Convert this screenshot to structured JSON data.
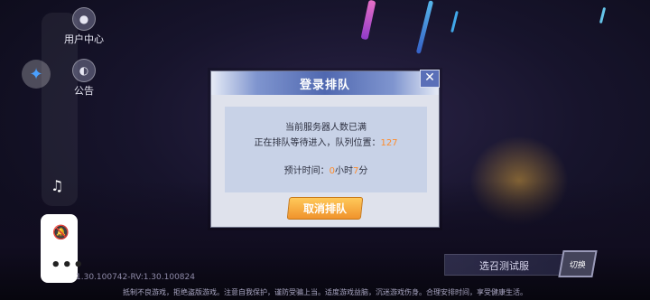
{
  "sidebar": {
    "user_center_label": "用户中心",
    "announcement_label": "公告"
  },
  "footer": {
    "version_text": "1.30.100742-RV:1.30.100824",
    "health_notice": "抵制不良游戏，拒绝盗版游戏。注意自我保护，谨防受骗上当。适度游戏益脑，沉迷游戏伤身。合理安排时间，享受健康生活。"
  },
  "server": {
    "select_label": "选召测试服",
    "switch_label": "切换"
  },
  "modal": {
    "title": "登录排队",
    "line1": "当前服务器人数已满",
    "line2_prefix": "正在排队等待进入，队列位置：",
    "queue_position": "127",
    "time_prefix": "预计时间：",
    "hours": "0",
    "hours_unit": "小时",
    "minutes": "7",
    "minutes_unit": "分",
    "cancel_label": "取消排队",
    "close_glyph": "✕"
  }
}
